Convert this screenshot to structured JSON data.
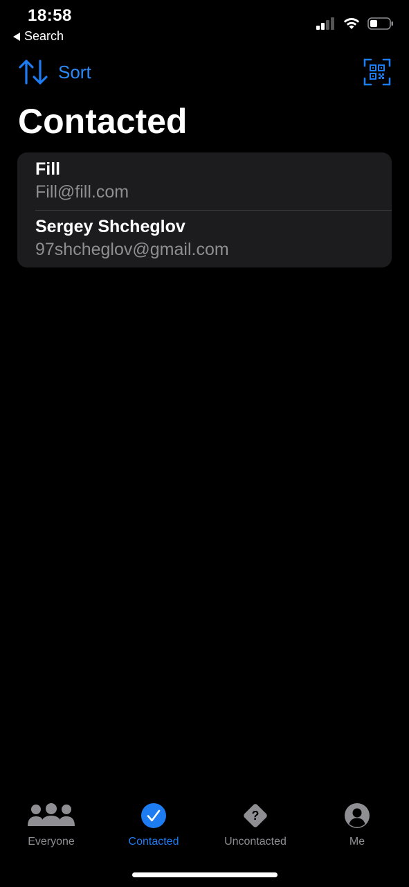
{
  "status_bar": {
    "time": "18:58",
    "back_label": "Search"
  },
  "nav": {
    "sort_label": "Sort",
    "qr_icon": "qr-code-scan-icon",
    "accent_color": "#1e7cf2"
  },
  "page": {
    "title": "Contacted"
  },
  "contacts": [
    {
      "name": "Fill",
      "email": "Fill@fill.com"
    },
    {
      "name": "Sergey Shcheglov",
      "email": "97shcheglov@gmail.com"
    }
  ],
  "tabs": [
    {
      "label": "Everyone",
      "icon": "people-group-icon",
      "active": false
    },
    {
      "label": "Contacted",
      "icon": "checkmark-circle-icon",
      "active": true
    },
    {
      "label": "Uncontacted",
      "icon": "question-diamond-icon",
      "active": false
    },
    {
      "label": "Me",
      "icon": "person-circle-icon",
      "active": false
    }
  ]
}
